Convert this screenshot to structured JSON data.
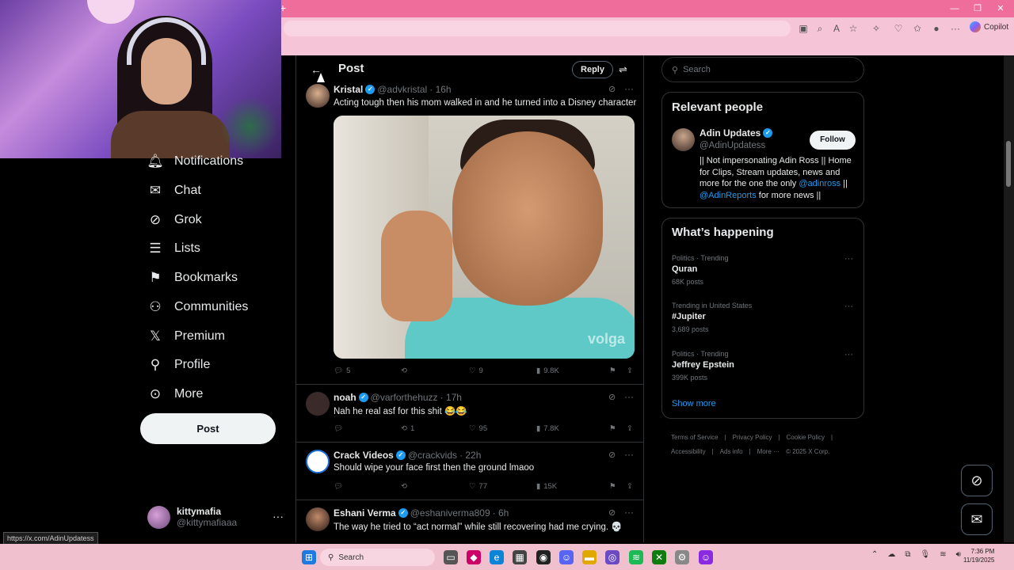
{
  "browser": {
    "new_tab": "+",
    "window_controls": [
      "—",
      "❐",
      "✕"
    ],
    "toolbar_icons": [
      "tab-action-icon",
      "zoom-icon",
      "read-aloud-icon",
      "favorite-icon",
      "extensions-icon",
      "browser-essentials-icon",
      "favorites-icon",
      "profile-icon",
      "menu-icon"
    ],
    "copilot_label": "Copilot"
  },
  "sidebar": {
    "items": [
      {
        "label": "Notifications",
        "icon": "bell-icon"
      },
      {
        "label": "Chat",
        "icon": "mail-icon"
      },
      {
        "label": "Grok",
        "icon": "grok-icon"
      },
      {
        "label": "Lists",
        "icon": "list-icon"
      },
      {
        "label": "Bookmarks",
        "icon": "bookmark-icon"
      },
      {
        "label": "Communities",
        "icon": "communities-icon"
      },
      {
        "label": "Premium",
        "icon": "x-logo-icon"
      },
      {
        "label": "Profile",
        "icon": "person-icon"
      },
      {
        "label": "More",
        "icon": "more-circle-icon"
      }
    ],
    "post_button": "Post",
    "account": {
      "name": "kittymafia",
      "handle": "@kittymafiaaa"
    }
  },
  "status_url": "https://x.com/AdinUpdatess",
  "main": {
    "header_title": "Post",
    "reply_label": "Reply",
    "post": {
      "name": "Kristal",
      "handle": "@advkristal",
      "time": "· 16h",
      "text": "Acting tough then his mom walked in and he turned into a Disney character",
      "media_watermark": "volga",
      "replies": "5",
      "reposts": "",
      "likes": "9",
      "views": "9.8K"
    },
    "replies": [
      {
        "name": "noah",
        "handle": "@varforthehuzz",
        "time": "· 17h",
        "text": "Nah he real asf for this shit 😂😂",
        "replies": "",
        "reposts": "1",
        "likes": "95",
        "views": "7.8K",
        "avatar_color": "#3b2a2a"
      },
      {
        "name": "Crack Videos",
        "handle": "@crackvids",
        "time": "· 22h",
        "text": "Should wipe your face first then the ground lmaoo",
        "replies": "",
        "reposts": "",
        "likes": "77",
        "views": "15K",
        "avatar_color": "#ffffff"
      },
      {
        "name": "Eshani Verma",
        "handle": "@eshaniverma809",
        "time": "· 6h",
        "text": "The way he tried to “act normal” while still recovering had me crying. 💀",
        "replies": "",
        "reposts": "",
        "likes": "",
        "views": "",
        "avatar_color": "#6b4a3a"
      }
    ]
  },
  "right": {
    "search_placeholder": "Search",
    "relevant_title": "Relevant people",
    "person": {
      "name": "Adin Updates",
      "handle": "@AdinUpdatess",
      "follow": "Follow",
      "bio_1": "|| Not impersonating Adin Ross || Home for Clips, Stream updates, news and more for the one the only ",
      "bio_link_1": "@adinross",
      "bio_2": " || ",
      "bio_link_2": "@AdinReports",
      "bio_3": " for more news ||"
    },
    "happening_title": "What’s happening",
    "trends": [
      {
        "meta": "Politics · Trending",
        "name": "Quran",
        "count": "68K posts"
      },
      {
        "meta": "Trending in United States",
        "name": "#Jupiter",
        "count": "3,689 posts"
      },
      {
        "meta": "Politics · Trending",
        "name": "Jeffrey Epstein",
        "count": "399K posts"
      }
    ],
    "show_more": "Show more",
    "footer": [
      "Terms of Service",
      "|",
      "Privacy Policy",
      "|",
      "Cookie Policy",
      "|",
      "Accessibility",
      "|",
      "Ads info",
      "|",
      "More ···",
      "© 2025 X Corp."
    ]
  },
  "taskbar": {
    "search_label": "Search",
    "time": "7:36 PM",
    "date": "11/19/2025"
  },
  "colors": {
    "accent": "#1d9bf0",
    "browser_tab": "#ee6d9b",
    "browser_toolbar": "#f6c4d7",
    "taskbar": "#f1c0cf"
  }
}
